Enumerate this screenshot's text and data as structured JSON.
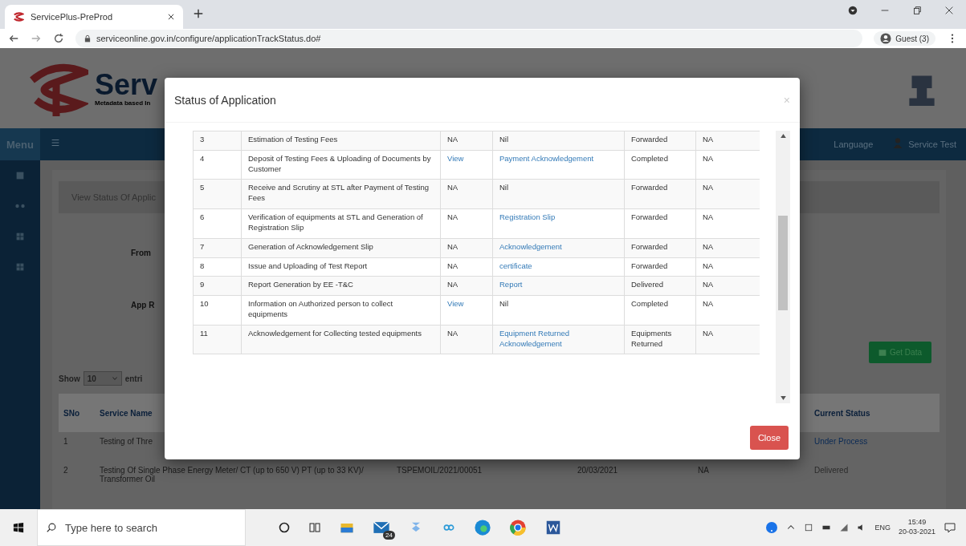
{
  "browser": {
    "tab_title": "ServicePlus-PreProd",
    "url": "serviceonline.gov.in/configure/applicationTrackStatus.do#",
    "profile": "Guest (3)"
  },
  "header": {
    "logo_text": "Serv",
    "logo_subtitle": "Metadata based In"
  },
  "menu_bar": {
    "label": "Menu",
    "language": "Language",
    "user": "Service Test"
  },
  "content": {
    "breadcrumb": "View Status Of Applic",
    "from_label": "From",
    "app_label": "App R",
    "get_data": "Get Data",
    "show": "Show",
    "page_size": "10",
    "entries": "entri",
    "columns": [
      "SNo",
      "Service Name",
      "Current Status"
    ],
    "rows": [
      {
        "sno": "1",
        "service": "Testing of Thre",
        "status": "Under Process",
        "status_link": true
      },
      {
        "sno": "2",
        "service": "Testing Of Single Phase Energy Meter/ CT (up to 650 V) PT (up to 33 KV)/ Transformer Oil",
        "ref": "TSPEMOIL/2021/00051",
        "date": "20/03/2021",
        "col5": "NA",
        "status": "Delivered",
        "status_link": false
      }
    ]
  },
  "modal": {
    "title": "Status of Application",
    "close_icon": "×",
    "close_label": "Close",
    "rows": [
      {
        "no": "3",
        "stage": "Estimation of Testing Fees",
        "col3": {
          "text": "NA",
          "link": false
        },
        "document": {
          "text": "Nil",
          "link": false
        },
        "status": "Forwarded",
        "col6": "NA"
      },
      {
        "no": "4",
        "stage": "Deposit of Testing Fees & Uploading of Documents by Customer",
        "col3": {
          "text": "View",
          "link": true
        },
        "document": {
          "text": "Payment Acknowledgement",
          "link": true
        },
        "status": "Completed",
        "col6": "NA"
      },
      {
        "no": "5",
        "stage": "Receive and Scrutiny at STL after Payment of Testing Fees",
        "col3": {
          "text": "NA",
          "link": false
        },
        "document": {
          "text": "Nil",
          "link": false
        },
        "status": "Forwarded",
        "col6": "NA"
      },
      {
        "no": "6",
        "stage": "Verification of equipments at STL and Generation of Registration Slip",
        "col3": {
          "text": "NA",
          "link": false
        },
        "document": {
          "text": "Registration Slip",
          "link": true
        },
        "status": "Forwarded",
        "col6": "NA"
      },
      {
        "no": "7",
        "stage": "Generation of Acknowledgement Slip",
        "col3": {
          "text": "NA",
          "link": false
        },
        "document": {
          "text": "Acknowledgement",
          "link": true
        },
        "status": "Forwarded",
        "col6": "NA"
      },
      {
        "no": "8",
        "stage": "Issue and Uploading of Test Report",
        "col3": {
          "text": "NA",
          "link": false
        },
        "document": {
          "text": "certificate",
          "link": true
        },
        "status": "Forwarded",
        "col6": "NA"
      },
      {
        "no": "9",
        "stage": "Report Generation by EE -T&C",
        "col3": {
          "text": "NA",
          "link": false
        },
        "document": {
          "text": "Report",
          "link": true
        },
        "status": "Delivered",
        "col6": "NA"
      },
      {
        "no": "10",
        "stage": "Information on Authorized person to collect equipments",
        "col3": {
          "text": "View",
          "link": true
        },
        "document": {
          "text": "Nil",
          "link": false
        },
        "status": "Completed",
        "col6": "NA"
      },
      {
        "no": "11",
        "stage": "Acknowledgement for Collecting tested equipments",
        "col3": {
          "text": "NA",
          "link": false
        },
        "document": {
          "text": "Equipment Returned Acknowledgement",
          "link": true
        },
        "status": "Equipments Returned",
        "col6": "NA"
      }
    ]
  },
  "taskbar": {
    "search_placeholder": "Type here to search",
    "mail_badge": "24",
    "language": "ENG",
    "time": "15:49",
    "date": "20-03-2021"
  }
}
